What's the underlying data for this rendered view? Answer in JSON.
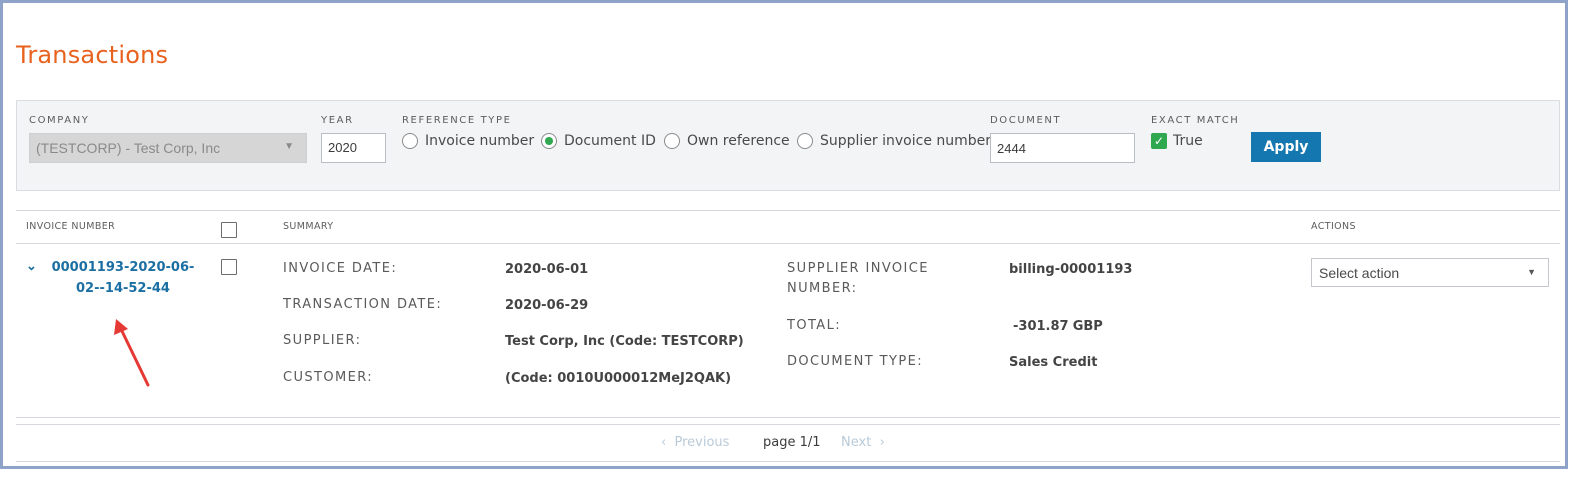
{
  "page": {
    "title": "Transactions"
  },
  "filters": {
    "company": {
      "label": "COMPANY",
      "value": "(TESTCORP) - Test Corp, Inc"
    },
    "year": {
      "label": "YEAR",
      "value": "2020"
    },
    "reference_type": {
      "label": "REFERENCE TYPE",
      "options": [
        {
          "label": "Invoice number",
          "selected": false
        },
        {
          "label": "Document ID",
          "selected": true
        },
        {
          "label": "Own reference",
          "selected": false
        },
        {
          "label": "Supplier invoice number",
          "selected": false
        }
      ]
    },
    "document": {
      "label": "DOCUMENT",
      "value": "2444"
    },
    "exact_match": {
      "label": "EXACT MATCH",
      "checkbox_label": "True",
      "checked": true
    },
    "apply_label": "Apply"
  },
  "table": {
    "headers": {
      "invoice_number": "INVOICE NUMBER",
      "summary": "SUMMARY",
      "actions": "ACTIONS"
    },
    "row": {
      "invoice_number": "00001193-2020-06-02--14-52-44",
      "left_fields": [
        {
          "label": "INVOICE DATE:",
          "value": "2020-06-01"
        },
        {
          "label": "TRANSACTION DATE:",
          "value": "2020-06-29"
        },
        {
          "label": "SUPPLIER:",
          "value": "Test Corp, Inc (Code: TESTCORP)"
        },
        {
          "label": "CUSTOMER:",
          "value": "(Code: 0010U000012MeJ2QAK)"
        }
      ],
      "right_fields": [
        {
          "label": "SUPPLIER INVOICE NUMBER:",
          "value": "billing-00001193"
        },
        {
          "label": "TOTAL:",
          "value": "-301.87",
          "unit": "GBP"
        },
        {
          "label": "DOCUMENT TYPE:",
          "value": "Sales Credit"
        }
      ],
      "action_placeholder": "Select action"
    }
  },
  "pagination": {
    "previous": "Previous",
    "page": "page 1/1",
    "next": "Next"
  },
  "colors": {
    "title": "#e8621e",
    "link": "#1b6fa3",
    "apply": "#1577b0",
    "check": "#2fa84f",
    "annotation_arrow": "#e53935"
  }
}
